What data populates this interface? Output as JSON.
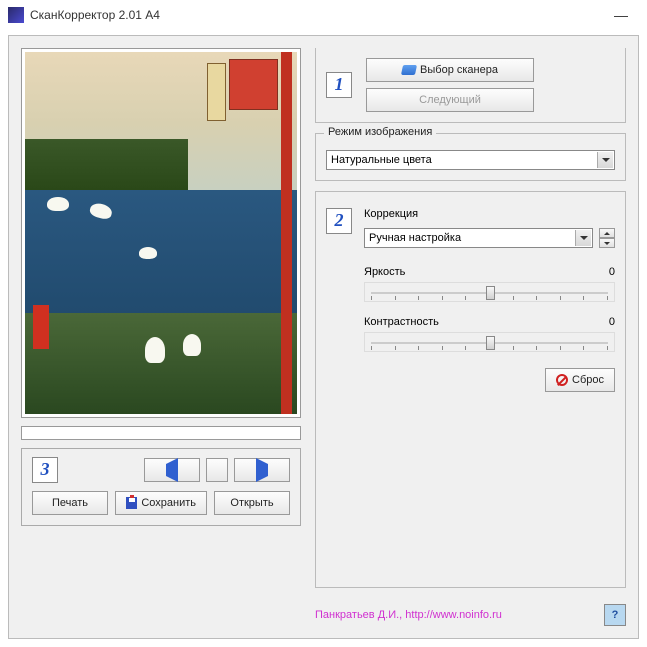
{
  "window": {
    "title": "СканКорректор 2.01 А4"
  },
  "scanner": {
    "step_num": "1",
    "select_label": "Выбор сканера",
    "next_label": "Следующий"
  },
  "image_mode": {
    "group_label": "Режим изображения",
    "value": "Натуральные цвета"
  },
  "correction": {
    "step_num": "2",
    "title": "Коррекция",
    "mode_value": "Ручная настройка",
    "brightness_label": "Яркость",
    "brightness_value": "0",
    "contrast_label": "Контрастность",
    "contrast_value": "0",
    "reset_label": "Сброс"
  },
  "nav": {
    "step_num": "3",
    "print_label": "Печать",
    "save_label": "Сохранить",
    "open_label": "Открыть"
  },
  "footer": {
    "credit": "Панкратьев Д.И., http://www.noinfo.ru",
    "help": "?"
  }
}
